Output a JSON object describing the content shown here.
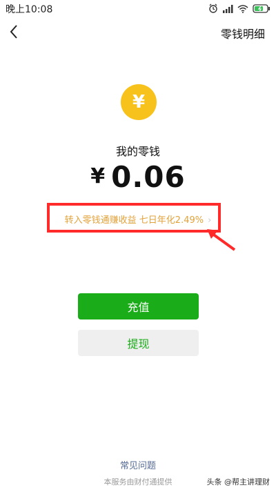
{
  "status_bar": {
    "time": "晚上10:08"
  },
  "header": {
    "detail_label": "零钱明细"
  },
  "balance": {
    "currency_symbol": "¥",
    "title": "我的零钱",
    "yen": "¥",
    "amount": "0.06"
  },
  "promo": {
    "text": "转入零钱通赚收益 七日年化2.49%",
    "chevron": "›"
  },
  "actions": {
    "recharge_label": "充值",
    "withdraw_label": "提现"
  },
  "footer": {
    "faq_label": "常见问题",
    "provider_note": "本服务由财付通提供"
  },
  "watermark": {
    "text": "头条 @帮主讲理财"
  },
  "colors": {
    "accent_green": "#1aad19",
    "coin_yellow": "#f7c21b",
    "promo_orange": "#e2a23a",
    "annotation_red": "#ff2b2b",
    "link_blue": "#576b95"
  },
  "icons": {
    "back": "back-arrow-icon",
    "alarm": "alarm-icon",
    "signal": "signal-icon",
    "wifi": "wifi-icon",
    "battery": "battery-icon"
  }
}
